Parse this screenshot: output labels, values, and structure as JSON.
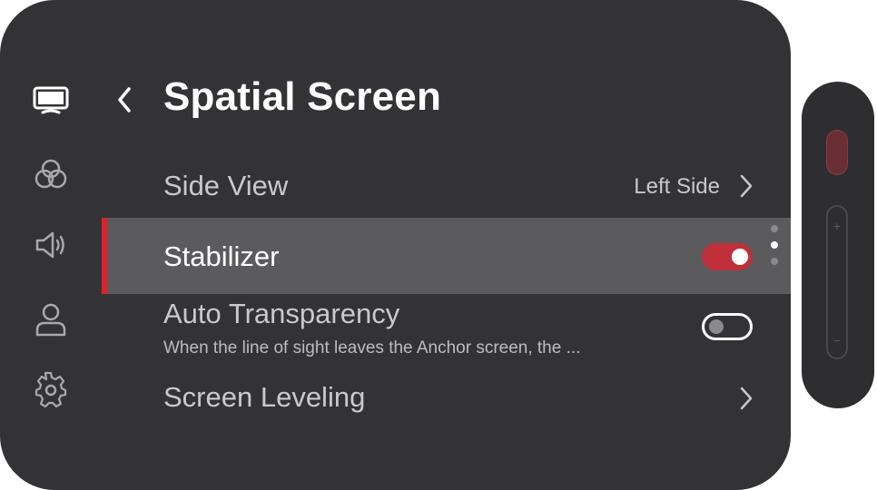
{
  "header": {
    "title": "Spatial Screen"
  },
  "sidebar": {
    "items": [
      {
        "icon": "monitor-icon",
        "active": true
      },
      {
        "icon": "color-circles-icon",
        "active": false
      },
      {
        "icon": "speaker-icon",
        "active": false
      },
      {
        "icon": "user-icon",
        "active": false
      },
      {
        "icon": "gear-icon",
        "active": false
      }
    ]
  },
  "settings": {
    "side_view": {
      "label": "Side View",
      "value": "Left Side"
    },
    "stabilizer": {
      "label": "Stabilizer",
      "enabled": true
    },
    "auto_transparency": {
      "label": "Auto Transparency",
      "description": "When the line of sight leaves the Anchor screen, the ...",
      "enabled": false
    },
    "screen_leveling": {
      "label": "Screen Leveling"
    }
  },
  "remote": {
    "plus_label": "+",
    "minus_label": "−"
  },
  "colors": {
    "panel_bg": "#333335",
    "selected_row_bg": "#5b5b5d",
    "accent_red": "#e0202a",
    "toggle_on": "#c0303b"
  }
}
